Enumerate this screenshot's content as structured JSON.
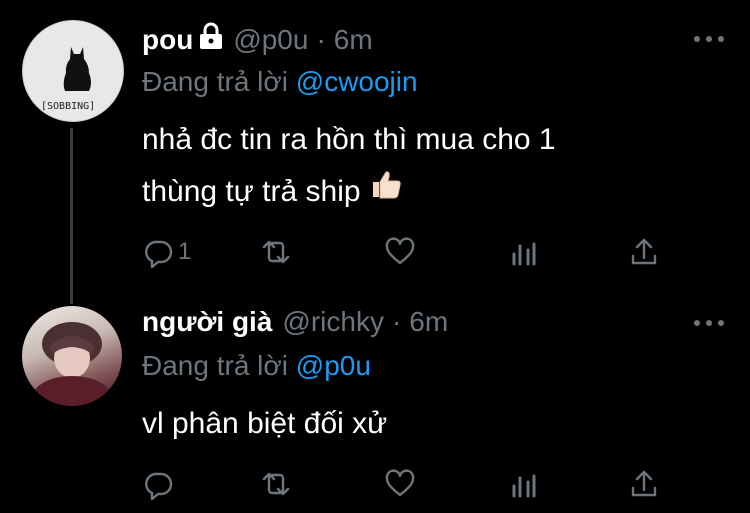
{
  "tweets": [
    {
      "name": "pou",
      "handle": "@p0u",
      "dot": "·",
      "time": "6m",
      "reply_prefix": "Đang trả lời",
      "reply_to": "@cwoojin",
      "body_line1": "nhả đc tin ra hồn thì mua cho 1",
      "body_line2": "thùng tự trả ship",
      "avatar_caption": "[SOBBING]",
      "reply_count": "1",
      "locked": true
    },
    {
      "name": "người già",
      "handle": "@richky",
      "dot": "·",
      "time": "6m",
      "reply_prefix": "Đang trả lời",
      "reply_to": "@p0u",
      "body_line1": "vl phân biệt đối xử",
      "reply_count": ""
    }
  ],
  "icons": [
    "lock-icon",
    "more-icon",
    "reply-icon",
    "retweet-icon",
    "like-icon",
    "analytics-icon",
    "share-icon",
    "thumbs-up-emoji"
  ],
  "colors": {
    "background": "#000000",
    "secondary_text": "#6e767d",
    "link": "#1d9bf0",
    "text": "#ffffff"
  }
}
